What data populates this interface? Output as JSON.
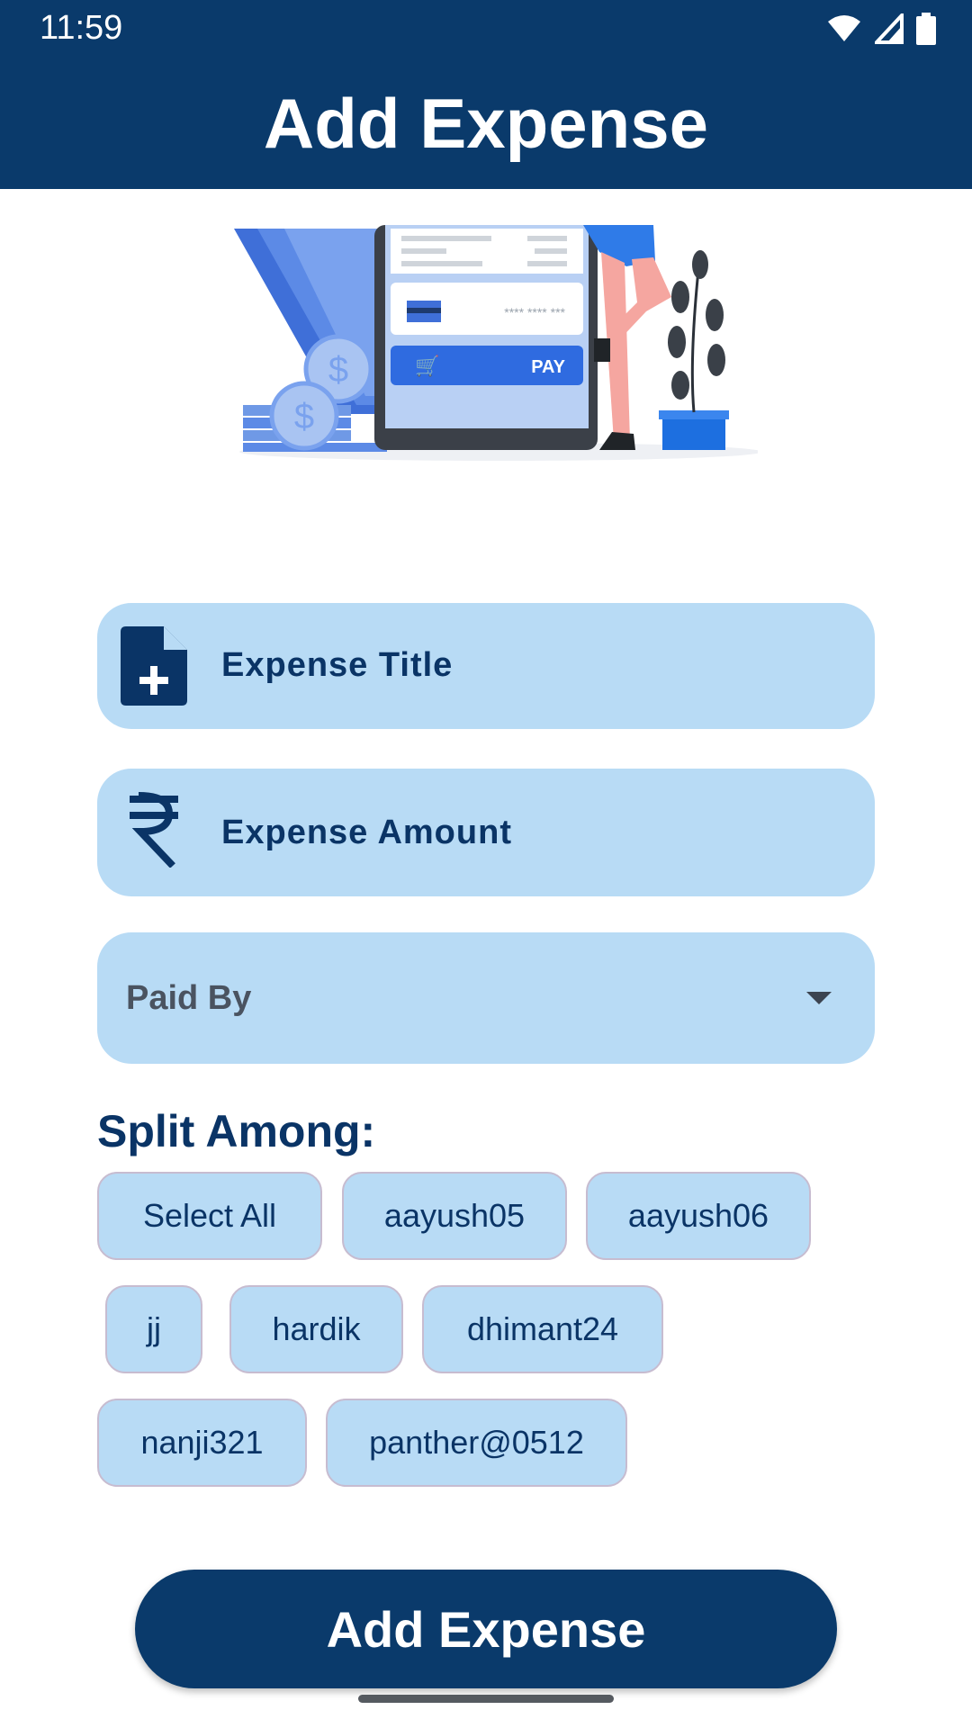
{
  "status_bar": {
    "time": "11:59"
  },
  "header": {
    "title": "Add Expense"
  },
  "form": {
    "title_placeholder": "Expense Title",
    "amount_placeholder": "Expense Amount",
    "paid_by_label": "Paid By"
  },
  "split": {
    "heading": "Split Among:",
    "select_all": "Select All",
    "members": [
      "aayush05",
      "aayush06",
      "jj",
      "hardik",
      "dhimant24",
      "nanji321",
      "panther@0512"
    ]
  },
  "illustration": {
    "pay_label": "PAY",
    "card_mask": "**** **** ***"
  },
  "submit": {
    "label": "Add Expense"
  },
  "colors": {
    "primary": "#0a3a6b",
    "field_bg": "#b8dbf5",
    "chip_border": "#c7bcd0"
  }
}
